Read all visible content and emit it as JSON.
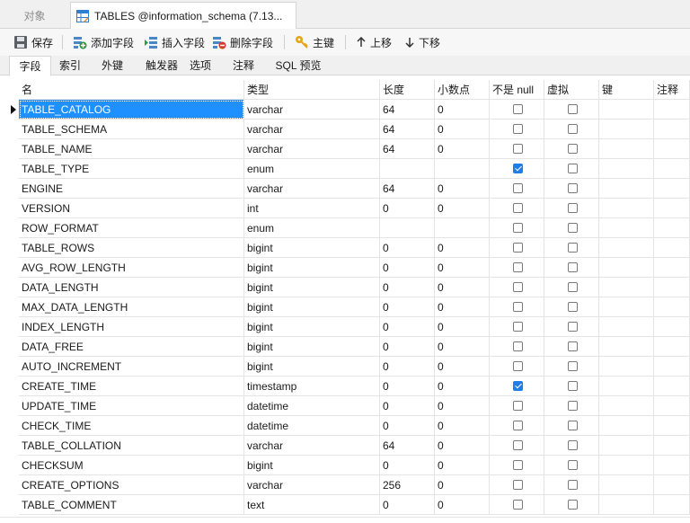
{
  "doc_tabs": {
    "objects_label": "对象",
    "active_label": "TABLES @information_schema (7.13..."
  },
  "toolbar": {
    "save_label": "保存",
    "add_field_label": "添加字段",
    "insert_field_label": "插入字段",
    "delete_field_label": "删除字段",
    "primary_key_label": "主键",
    "move_up_label": "上移",
    "move_down_label": "下移"
  },
  "sub_tabs": [
    {
      "label": "字段",
      "active": true
    },
    {
      "label": "索引"
    },
    {
      "label": "外键"
    },
    {
      "label": "触发器"
    },
    {
      "label": "选项"
    },
    {
      "label": "注释"
    },
    {
      "label": "SQL 预览"
    }
  ],
  "columns": [
    "名",
    "类型",
    "长度",
    "小数点",
    "不是 null",
    "虚拟",
    "键",
    "注释"
  ],
  "rows": [
    {
      "name": "TABLE_CATALOG",
      "type": "varchar",
      "length": "64",
      "decimals": "0",
      "not_null": false,
      "virtual": false,
      "selected": true
    },
    {
      "name": "TABLE_SCHEMA",
      "type": "varchar",
      "length": "64",
      "decimals": "0",
      "not_null": false,
      "virtual": false
    },
    {
      "name": "TABLE_NAME",
      "type": "varchar",
      "length": "64",
      "decimals": "0",
      "not_null": false,
      "virtual": false
    },
    {
      "name": "TABLE_TYPE",
      "type": "enum",
      "length": "",
      "decimals": "",
      "not_null": true,
      "virtual": false
    },
    {
      "name": "ENGINE",
      "type": "varchar",
      "length": "64",
      "decimals": "0",
      "not_null": false,
      "virtual": false
    },
    {
      "name": "VERSION",
      "type": "int",
      "length": "0",
      "decimals": "0",
      "not_null": false,
      "virtual": false
    },
    {
      "name": "ROW_FORMAT",
      "type": "enum",
      "length": "",
      "decimals": "",
      "not_null": false,
      "virtual": false
    },
    {
      "name": "TABLE_ROWS",
      "type": "bigint",
      "length": "0",
      "decimals": "0",
      "not_null": false,
      "virtual": false
    },
    {
      "name": "AVG_ROW_LENGTH",
      "type": "bigint",
      "length": "0",
      "decimals": "0",
      "not_null": false,
      "virtual": false
    },
    {
      "name": "DATA_LENGTH",
      "type": "bigint",
      "length": "0",
      "decimals": "0",
      "not_null": false,
      "virtual": false
    },
    {
      "name": "MAX_DATA_LENGTH",
      "type": "bigint",
      "length": "0",
      "decimals": "0",
      "not_null": false,
      "virtual": false
    },
    {
      "name": "INDEX_LENGTH",
      "type": "bigint",
      "length": "0",
      "decimals": "0",
      "not_null": false,
      "virtual": false
    },
    {
      "name": "DATA_FREE",
      "type": "bigint",
      "length": "0",
      "decimals": "0",
      "not_null": false,
      "virtual": false
    },
    {
      "name": "AUTO_INCREMENT",
      "type": "bigint",
      "length": "0",
      "decimals": "0",
      "not_null": false,
      "virtual": false
    },
    {
      "name": "CREATE_TIME",
      "type": "timestamp",
      "length": "0",
      "decimals": "0",
      "not_null": true,
      "virtual": false
    },
    {
      "name": "UPDATE_TIME",
      "type": "datetime",
      "length": "0",
      "decimals": "0",
      "not_null": false,
      "virtual": false
    },
    {
      "name": "CHECK_TIME",
      "type": "datetime",
      "length": "0",
      "decimals": "0",
      "not_null": false,
      "virtual": false
    },
    {
      "name": "TABLE_COLLATION",
      "type": "varchar",
      "length": "64",
      "decimals": "0",
      "not_null": false,
      "virtual": false
    },
    {
      "name": "CHECKSUM",
      "type": "bigint",
      "length": "0",
      "decimals": "0",
      "not_null": false,
      "virtual": false
    },
    {
      "name": "CREATE_OPTIONS",
      "type": "varchar",
      "length": "256",
      "decimals": "0",
      "not_null": false,
      "virtual": false
    },
    {
      "name": "TABLE_COMMENT",
      "type": "text",
      "length": "0",
      "decimals": "0",
      "not_null": false,
      "virtual": false
    }
  ],
  "colors": {
    "selection": "#1e90ff",
    "checked": "#1e7ee6"
  }
}
